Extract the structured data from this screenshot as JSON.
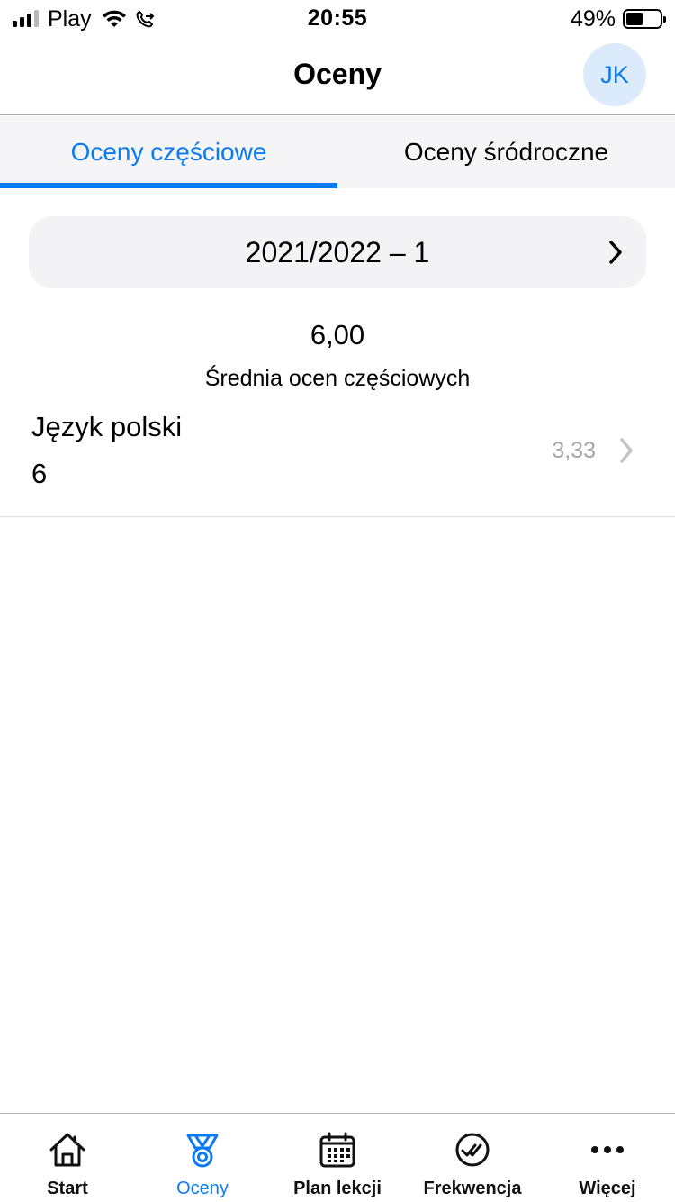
{
  "status_bar": {
    "carrier": "Play",
    "time": "20:55",
    "battery_percent": "49%",
    "battery_level": 0.49,
    "signal_bars": 3,
    "signal_bars_total": 4
  },
  "header": {
    "title": "Oceny",
    "avatar_initials": "JK"
  },
  "tabs": [
    {
      "label": "Oceny częściowe",
      "active": true
    },
    {
      "label": "Oceny śródroczne",
      "active": false
    }
  ],
  "period": {
    "label": "2021/2022 – 1",
    "icon": "chevron-right-icon"
  },
  "average": {
    "value": "6,00",
    "label": "Średnia ocen częściowych"
  },
  "subjects": [
    {
      "name": "Język polski",
      "grades": "6",
      "average": "3,33",
      "icon": "chevron-right-icon"
    }
  ],
  "tab_bar": [
    {
      "label": "Start",
      "icon": "home-icon",
      "active": false
    },
    {
      "label": "Oceny",
      "icon": "medal-icon",
      "active": true
    },
    {
      "label": "Plan lekcji",
      "icon": "calendar-icon",
      "active": false
    },
    {
      "label": "Frekwencja",
      "icon": "check-circle-icon",
      "active": false
    },
    {
      "label": "Więcej",
      "icon": "more-icon",
      "active": false
    }
  ],
  "colors": {
    "accent": "#0a7bf0",
    "avatar_bg": "#dcebfb",
    "tabs_bg": "#f5f5f7",
    "muted_text": "#a6a6aa"
  }
}
